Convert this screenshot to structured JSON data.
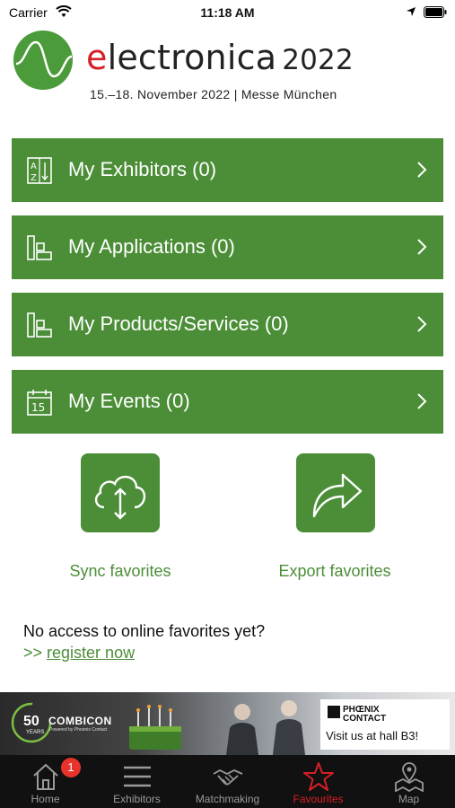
{
  "status_bar": {
    "carrier": "Carrier",
    "time": "11:18 AM"
  },
  "header": {
    "wordmark_e": "e",
    "wordmark_rest": "lectronica",
    "year": "2022",
    "subtitle": "15.–18. November 2022 | Messe München"
  },
  "favorites": [
    {
      "label": "My Exhibitors (0)",
      "icon": "az-sort-icon"
    },
    {
      "label": "My Applications (0)",
      "icon": "applications-icon"
    },
    {
      "label": "My Products/Services (0)",
      "icon": "products-icon"
    },
    {
      "label": "My Events (0)",
      "icon": "calendar-icon"
    }
  ],
  "actions": {
    "sync_label": "Sync favorites",
    "export_label": "Export favorites"
  },
  "notice": {
    "text": "No access to online favorites yet?",
    "prefix": ">> ",
    "link": "register now"
  },
  "banner": {
    "badge_number": "50",
    "badge_years": "YEARS",
    "product": "COMBICON",
    "powered": "Powered by Phoenix Contact",
    "brand_line1": "PHŒNIX",
    "brand_line2": "CONTACT",
    "cta": "Visit us at hall B3!"
  },
  "tabbar": {
    "tabs": [
      {
        "label": "Home",
        "icon": "home-icon",
        "badge": "1"
      },
      {
        "label": "Exhibitors",
        "icon": "menu-icon"
      },
      {
        "label": "Matchmaking",
        "icon": "handshake-icon"
      },
      {
        "label": "Favourites",
        "icon": "star-icon",
        "active": true
      },
      {
        "label": "Map",
        "icon": "map-pin-icon"
      }
    ]
  },
  "colors": {
    "primary_green": "#4b8e37",
    "accent_red": "#d42027",
    "tabbar_bg": "#111111",
    "badge_red": "#e8332d"
  }
}
